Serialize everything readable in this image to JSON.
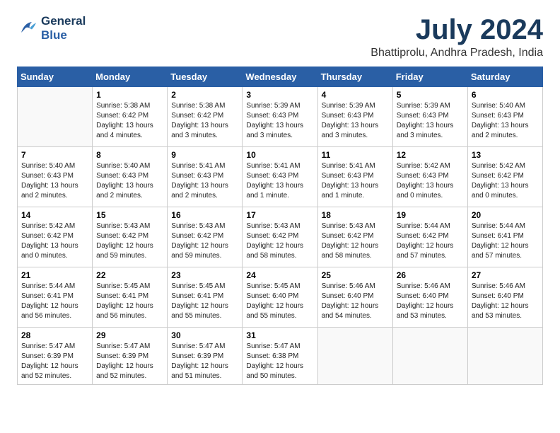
{
  "logo": {
    "line1": "General",
    "line2": "Blue"
  },
  "title": "July 2024",
  "location": "Bhattiprolu, Andhra Pradesh, India",
  "weekdays": [
    "Sunday",
    "Monday",
    "Tuesday",
    "Wednesday",
    "Thursday",
    "Friday",
    "Saturday"
  ],
  "weeks": [
    [
      {
        "day": "",
        "sunrise": "",
        "sunset": "",
        "daylight": ""
      },
      {
        "day": "1",
        "sunrise": "Sunrise: 5:38 AM",
        "sunset": "Sunset: 6:42 PM",
        "daylight": "Daylight: 13 hours and 4 minutes."
      },
      {
        "day": "2",
        "sunrise": "Sunrise: 5:38 AM",
        "sunset": "Sunset: 6:42 PM",
        "daylight": "Daylight: 13 hours and 3 minutes."
      },
      {
        "day": "3",
        "sunrise": "Sunrise: 5:39 AM",
        "sunset": "Sunset: 6:43 PM",
        "daylight": "Daylight: 13 hours and 3 minutes."
      },
      {
        "day": "4",
        "sunrise": "Sunrise: 5:39 AM",
        "sunset": "Sunset: 6:43 PM",
        "daylight": "Daylight: 13 hours and 3 minutes."
      },
      {
        "day": "5",
        "sunrise": "Sunrise: 5:39 AM",
        "sunset": "Sunset: 6:43 PM",
        "daylight": "Daylight: 13 hours and 3 minutes."
      },
      {
        "day": "6",
        "sunrise": "Sunrise: 5:40 AM",
        "sunset": "Sunset: 6:43 PM",
        "daylight": "Daylight: 13 hours and 2 minutes."
      }
    ],
    [
      {
        "day": "7",
        "sunrise": "Sunrise: 5:40 AM",
        "sunset": "Sunset: 6:43 PM",
        "daylight": "Daylight: 13 hours and 2 minutes."
      },
      {
        "day": "8",
        "sunrise": "Sunrise: 5:40 AM",
        "sunset": "Sunset: 6:43 PM",
        "daylight": "Daylight: 13 hours and 2 minutes."
      },
      {
        "day": "9",
        "sunrise": "Sunrise: 5:41 AM",
        "sunset": "Sunset: 6:43 PM",
        "daylight": "Daylight: 13 hours and 2 minutes."
      },
      {
        "day": "10",
        "sunrise": "Sunrise: 5:41 AM",
        "sunset": "Sunset: 6:43 PM",
        "daylight": "Daylight: 13 hours and 1 minute."
      },
      {
        "day": "11",
        "sunrise": "Sunrise: 5:41 AM",
        "sunset": "Sunset: 6:43 PM",
        "daylight": "Daylight: 13 hours and 1 minute."
      },
      {
        "day": "12",
        "sunrise": "Sunrise: 5:42 AM",
        "sunset": "Sunset: 6:43 PM",
        "daylight": "Daylight: 13 hours and 0 minutes."
      },
      {
        "day": "13",
        "sunrise": "Sunrise: 5:42 AM",
        "sunset": "Sunset: 6:42 PM",
        "daylight": "Daylight: 13 hours and 0 minutes."
      }
    ],
    [
      {
        "day": "14",
        "sunrise": "Sunrise: 5:42 AM",
        "sunset": "Sunset: 6:42 PM",
        "daylight": "Daylight: 13 hours and 0 minutes."
      },
      {
        "day": "15",
        "sunrise": "Sunrise: 5:43 AM",
        "sunset": "Sunset: 6:42 PM",
        "daylight": "Daylight: 12 hours and 59 minutes."
      },
      {
        "day": "16",
        "sunrise": "Sunrise: 5:43 AM",
        "sunset": "Sunset: 6:42 PM",
        "daylight": "Daylight: 12 hours and 59 minutes."
      },
      {
        "day": "17",
        "sunrise": "Sunrise: 5:43 AM",
        "sunset": "Sunset: 6:42 PM",
        "daylight": "Daylight: 12 hours and 58 minutes."
      },
      {
        "day": "18",
        "sunrise": "Sunrise: 5:43 AM",
        "sunset": "Sunset: 6:42 PM",
        "daylight": "Daylight: 12 hours and 58 minutes."
      },
      {
        "day": "19",
        "sunrise": "Sunrise: 5:44 AM",
        "sunset": "Sunset: 6:42 PM",
        "daylight": "Daylight: 12 hours and 57 minutes."
      },
      {
        "day": "20",
        "sunrise": "Sunrise: 5:44 AM",
        "sunset": "Sunset: 6:41 PM",
        "daylight": "Daylight: 12 hours and 57 minutes."
      }
    ],
    [
      {
        "day": "21",
        "sunrise": "Sunrise: 5:44 AM",
        "sunset": "Sunset: 6:41 PM",
        "daylight": "Daylight: 12 hours and 56 minutes."
      },
      {
        "day": "22",
        "sunrise": "Sunrise: 5:45 AM",
        "sunset": "Sunset: 6:41 PM",
        "daylight": "Daylight: 12 hours and 56 minutes."
      },
      {
        "day": "23",
        "sunrise": "Sunrise: 5:45 AM",
        "sunset": "Sunset: 6:41 PM",
        "daylight": "Daylight: 12 hours and 55 minutes."
      },
      {
        "day": "24",
        "sunrise": "Sunrise: 5:45 AM",
        "sunset": "Sunset: 6:40 PM",
        "daylight": "Daylight: 12 hours and 55 minutes."
      },
      {
        "day": "25",
        "sunrise": "Sunrise: 5:46 AM",
        "sunset": "Sunset: 6:40 PM",
        "daylight": "Daylight: 12 hours and 54 minutes."
      },
      {
        "day": "26",
        "sunrise": "Sunrise: 5:46 AM",
        "sunset": "Sunset: 6:40 PM",
        "daylight": "Daylight: 12 hours and 53 minutes."
      },
      {
        "day": "27",
        "sunrise": "Sunrise: 5:46 AM",
        "sunset": "Sunset: 6:40 PM",
        "daylight": "Daylight: 12 hours and 53 minutes."
      }
    ],
    [
      {
        "day": "28",
        "sunrise": "Sunrise: 5:47 AM",
        "sunset": "Sunset: 6:39 PM",
        "daylight": "Daylight: 12 hours and 52 minutes."
      },
      {
        "day": "29",
        "sunrise": "Sunrise: 5:47 AM",
        "sunset": "Sunset: 6:39 PM",
        "daylight": "Daylight: 12 hours and 52 minutes."
      },
      {
        "day": "30",
        "sunrise": "Sunrise: 5:47 AM",
        "sunset": "Sunset: 6:39 PM",
        "daylight": "Daylight: 12 hours and 51 minutes."
      },
      {
        "day": "31",
        "sunrise": "Sunrise: 5:47 AM",
        "sunset": "Sunset: 6:38 PM",
        "daylight": "Daylight: 12 hours and 50 minutes."
      },
      {
        "day": "",
        "sunrise": "",
        "sunset": "",
        "daylight": ""
      },
      {
        "day": "",
        "sunrise": "",
        "sunset": "",
        "daylight": ""
      },
      {
        "day": "",
        "sunrise": "",
        "sunset": "",
        "daylight": ""
      }
    ]
  ]
}
